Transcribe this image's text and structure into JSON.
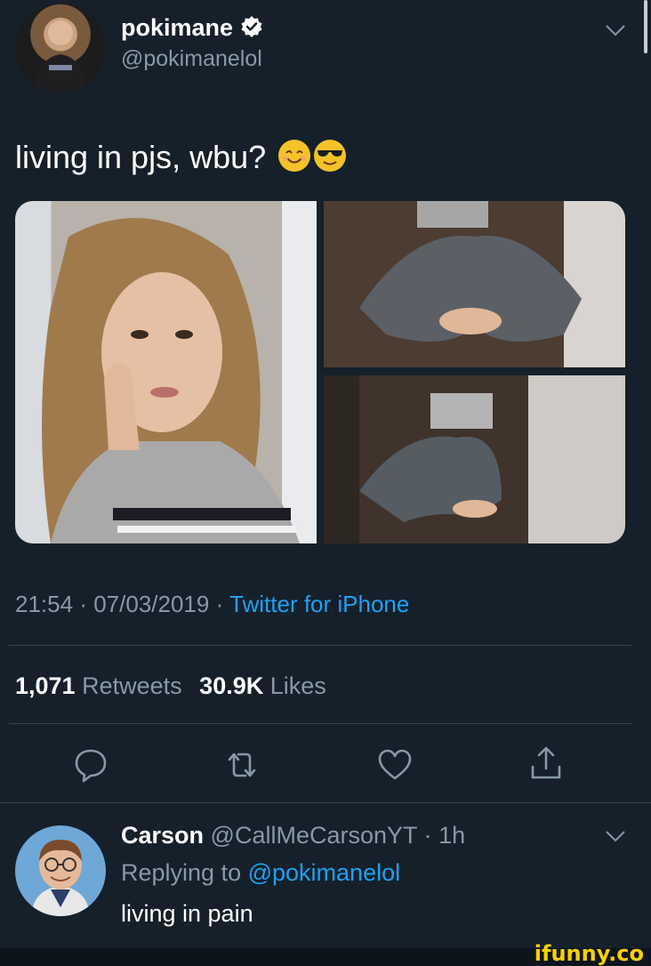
{
  "tweet": {
    "display_name": "pokimane",
    "handle": "@pokimanelol",
    "text": "living in pjs, wbu?",
    "emojis": [
      "smiling-face-icon",
      "sunglasses-face-icon"
    ],
    "time": "21:54",
    "date": "07/03/2019",
    "separator": "·",
    "source": "Twitter for iPhone",
    "retweets_count": "1,071",
    "retweets_label": "Retweets",
    "likes_count": "30.9K",
    "likes_label": "Likes"
  },
  "actions": [
    "reply-icon",
    "retweet-icon",
    "like-icon",
    "share-icon"
  ],
  "reply": {
    "display_name": "Carson",
    "handle": "@CallMeCarsonYT",
    "age": "1h",
    "replying_prefix": "Replying to",
    "replying_to": "@pokimanelol",
    "text": "living in pain"
  },
  "watermark": "ifunny.co",
  "colors": {
    "background": "#15202b",
    "accent": "#1da1f2",
    "muted": "#8899a6",
    "divider": "#38444d",
    "watermark": "#fdd000"
  }
}
